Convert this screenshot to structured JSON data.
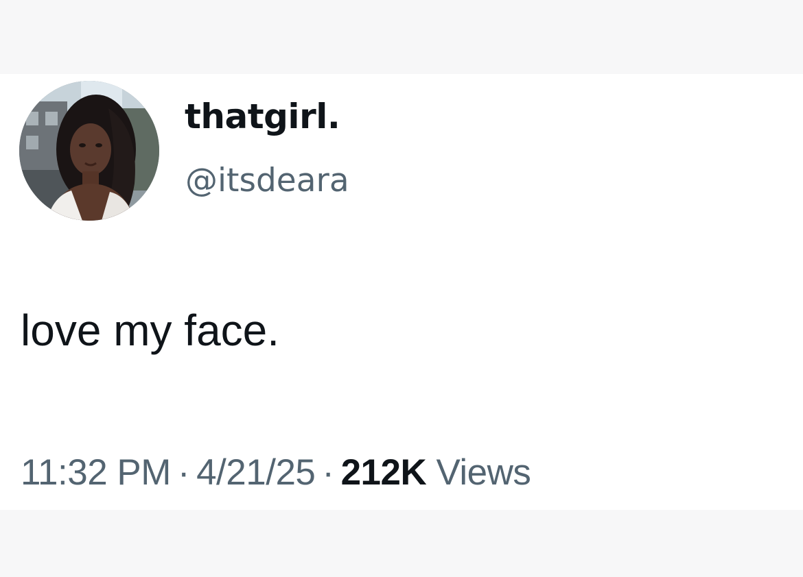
{
  "tweet": {
    "display_name": "thatgirl.",
    "handle": "@itsdeara",
    "text": "love my face.",
    "time": "11:32 PM",
    "date": "4/21/25",
    "separator": "·",
    "views_count": "212K",
    "views_label": "Views"
  },
  "colors": {
    "background": "#f7f7f8",
    "card": "#ffffff",
    "primary_text": "#0f1419",
    "secondary_text": "#536471"
  }
}
